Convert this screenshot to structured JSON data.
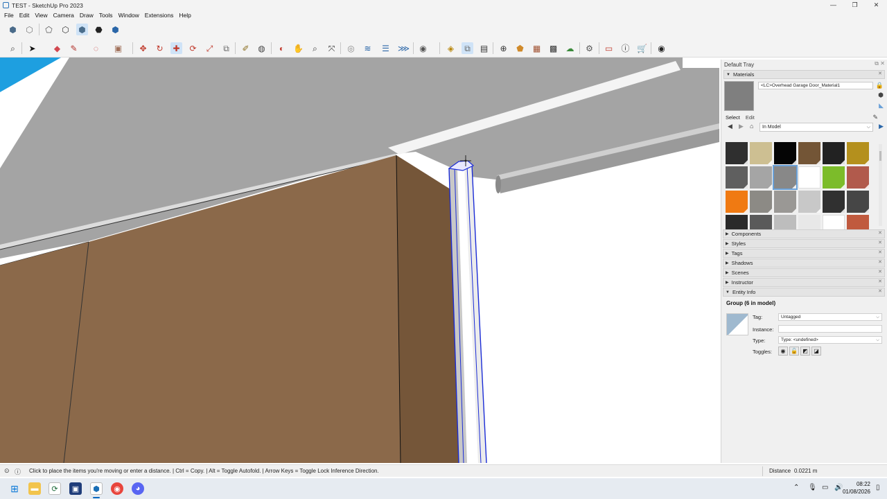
{
  "window": {
    "title": "TEST - SketchUp Pro 2023",
    "controls": [
      "—",
      "❐",
      "✕"
    ]
  },
  "menu": [
    "File",
    "Edit",
    "View",
    "Camera",
    "Draw",
    "Tools",
    "Window",
    "Extensions",
    "Help"
  ],
  "toolbar_icons": {
    "row1": [
      "iso-view-icon",
      "top-view-icon",
      "front-view-icon",
      "xray-icon",
      "shaded-icon",
      "textured-icon",
      "monochrome-icon"
    ],
    "row2": [
      "zoom-icon",
      "select-icon",
      "eraser-icon",
      "pencil-icon",
      "lasso-icon",
      "paint-bucket-icon",
      "push-pull-icon",
      "offset-icon",
      "move-icon",
      "rotate-icon",
      "scale-icon",
      "follow-me-icon",
      "tape-measure-icon",
      "protractor-icon",
      "orbit-icon",
      "pan-icon",
      "zoom-window-icon",
      "zoom-extents-icon",
      "section-plane-icon",
      "layers-icon",
      "warehouse-icon",
      "account-icon",
      "components-icon",
      "outliner-icon",
      "styles-icon",
      "add-location-icon",
      "extension-icon",
      "sandbox-icon",
      "cloud-icon",
      "settings-icon",
      "tags-icon",
      "info-icon",
      "shop-icon",
      "profile-icon"
    ]
  },
  "tray": {
    "title": "Default Tray",
    "materials": {
      "panel_label": "Materials",
      "current_name": "<LC>Overhead Garage Door_Material1",
      "tabs": {
        "select": "Select",
        "edit": "Edit"
      },
      "collection": "In Model",
      "swatches": [
        "#2f2f2f",
        "#cdbf92",
        "#050505",
        "#735536",
        "#222222",
        "#b4901d",
        "#5f5f5f",
        "#a5a5a5",
        "#888888",
        "#ffffff",
        "#7cbc2a",
        "#b15a4c",
        "#f07a12",
        "#8c8a85",
        "#9a9895",
        "#c8c8c8",
        "#303030",
        "#464646",
        "#2a2a2a",
        "#5a5a5a",
        "#bdbdbd",
        "#e8e8e8",
        "#ffffff",
        "#c05a3e"
      ],
      "selected_index": 8
    },
    "panels": [
      "Components",
      "Styles",
      "Tags",
      "Shadows",
      "Scenes",
      "Instructor",
      "Entity Info"
    ],
    "entity_info": {
      "heading": "Group (6 in model)",
      "tag_label": "Tag:",
      "tag_value": "Untagged",
      "instance_label": "Instance:",
      "instance_value": "",
      "type_label": "Type:",
      "type_value": "Type: <undefined>",
      "toggles_label": "Toggles:"
    }
  },
  "status": {
    "message": "Click to place the items you're moving or enter a distance. | Ctrl = Copy. | Alt = Toggle Autofold. | Arrow Keys = Toggle Lock Inference Direction.",
    "measure_label": "Distance",
    "measure_value": "0.0221 m"
  },
  "taskbar": {
    "time": "08:22",
    "date": "01/08/2026"
  },
  "colors": {
    "wall_front": "#8b694a",
    "wall_side": "#755639",
    "ceiling": "#a4a4a4",
    "selection": "#1a2bd6",
    "sky_accent": "#1e9fe0",
    "chrome": "#f3f3f3"
  }
}
